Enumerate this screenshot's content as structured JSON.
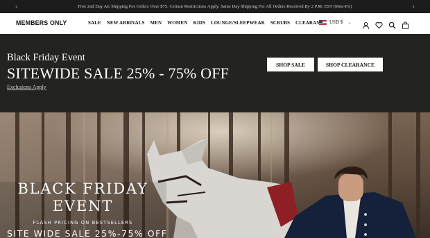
{
  "announcement": {
    "text": "Free 2nd Day Air Shipping For Orders Over $75. Certain Restrictions Apply. Same Day Shipping For All Orders Received By 2 P.M. EST (Mon-Fri)",
    "prev_icon": "chevron-left-icon",
    "next_icon": "chevron-right-icon"
  },
  "header": {
    "logo": "MEMBERS ONLY",
    "menu": [
      "SALE",
      "NEW ARRIVALS",
      "MEN",
      "WOMEN",
      "KIDS",
      "LOUNGE/SLEEPWEAR",
      "SCRUBS",
      "CLEARANCE"
    ],
    "currency": "USD $",
    "icons": [
      "account-icon",
      "heart-icon",
      "search-icon",
      "cart-icon"
    ]
  },
  "promo": {
    "subtitle": "Black Friday Event",
    "title": "SITEWIDE SALE 25% - 75% OFF",
    "exclusions": "Exclusions Apply",
    "shop_sale": "SHOP SALE",
    "shop_clearance": "SHOP CLEARANCE",
    "background": "#232322"
  },
  "hero": {
    "heading": "BLACK FRIDAY EVENT",
    "flash": "FLASH PRICING ON BESTSELLERS",
    "sale": "SITE WIDE SALE 25%-75% OFF"
  }
}
